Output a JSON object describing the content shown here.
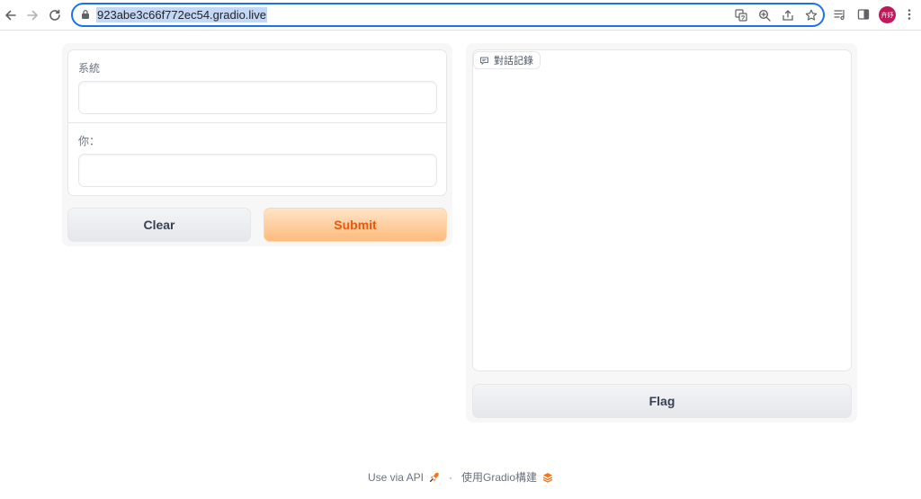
{
  "browser": {
    "url": "923abe3c66f772ec54.gradio.live",
    "profile_initials": "卉妤"
  },
  "inputs": {
    "system_label": "系統",
    "system_value": "",
    "user_label": "你：",
    "user_value": ""
  },
  "actions": {
    "clear_label": "Clear",
    "submit_label": "Submit",
    "flag_label": "Flag"
  },
  "chat": {
    "label": "對話記錄"
  },
  "footer": {
    "api_label": "Use via API",
    "separator": "·",
    "built_with": "使用Gradio構建"
  },
  "colors": {
    "accent": "#ea580c",
    "omnibox_border": "#1a73e8",
    "profile": "#c2185b"
  }
}
